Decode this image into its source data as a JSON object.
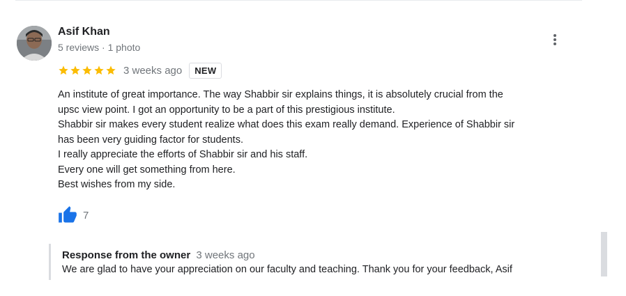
{
  "review": {
    "author": {
      "name": "Asif Khan",
      "meta": "5 reviews · 1 photo"
    },
    "rating": 5,
    "time": "3 weeks ago",
    "badge": "NEW",
    "text_lines": [
      "An institute of great importance. The way Shabbir sir explains things,  it is absolutely crucial from the",
      "upsc view point. I got an opportunity to be a part of this prestigious institute.",
      "Shabbir sir makes every student realize what does this exam really demand. Experience of Shabbir sir",
      "has been very guiding factor for students.",
      "I really appreciate the efforts of Shabbir sir and his staff.",
      "Every one will get something from here.",
      "Best wishes from my side."
    ],
    "likes": "7"
  },
  "owner_response": {
    "title": "Response from the owner",
    "time": "3 weeks ago",
    "text": "We are glad to have your appreciation on our faculty and teaching. Thank you for your feedback, Asif"
  },
  "colors": {
    "star": "#fbbc04",
    "like_icon": "#1a73e8",
    "secondary_text": "#70757a"
  },
  "icons": [
    "more-vert-icon",
    "star-icon",
    "thumb-up-icon"
  ]
}
